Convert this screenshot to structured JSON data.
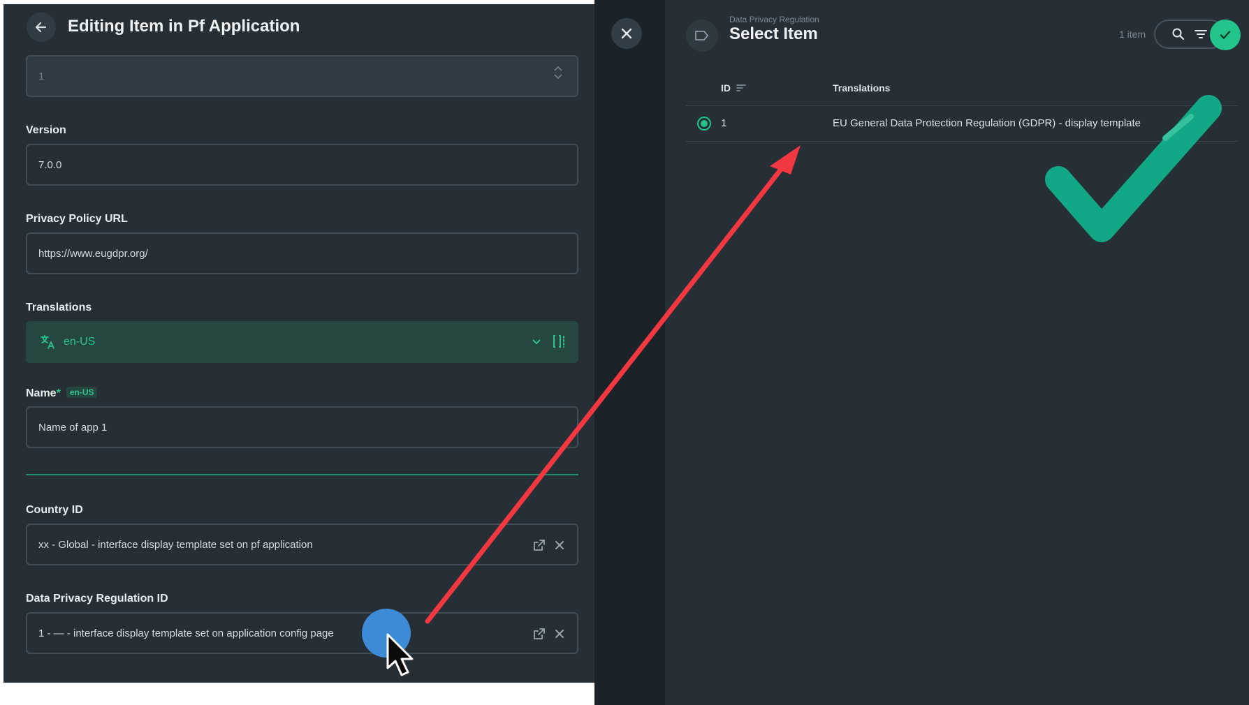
{
  "left": {
    "title": "Editing Item in Pf Application",
    "id_field": {
      "value": "1"
    },
    "version": {
      "label": "Version",
      "value": "7.0.0"
    },
    "privacy_url": {
      "label": "Privacy Policy URL",
      "value": "https://www.eugdpr.org/"
    },
    "translations": {
      "label": "Translations",
      "language": "en-US"
    },
    "name": {
      "label": "Name",
      "required_mark": "*",
      "lang_badge": "en-US",
      "value": "Name of app 1"
    },
    "country": {
      "label": "Country ID",
      "value": "xx - Global - interface display template set on pf application"
    },
    "dpr": {
      "label": "Data Privacy Regulation ID",
      "value": "1 - — - interface display template set on application config page"
    }
  },
  "drawer": {
    "eyebrow": "Data Privacy Regulation",
    "title": "Select Item",
    "count": "1 item",
    "columns": {
      "id": "ID",
      "translations": "Translations"
    },
    "rows": [
      {
        "id": "1",
        "translations": "EU General Data Protection Regulation (GDPR) - display template"
      }
    ]
  },
  "colors": {
    "accent": "#23c48c",
    "annotation_arrow": "#f1373f",
    "annotation_dot": "#3d8bd7"
  }
}
